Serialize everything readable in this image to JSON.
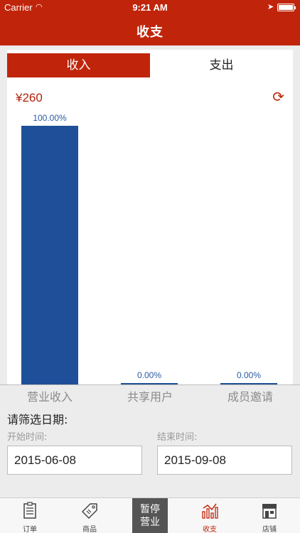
{
  "status_bar": {
    "carrier": "Carrier",
    "time": "9:21 AM"
  },
  "nav": {
    "title": "收支"
  },
  "segments": [
    {
      "label": "收入",
      "active": true
    },
    {
      "label": "支出",
      "active": false
    }
  ],
  "amount": "¥260",
  "chart_data": {
    "type": "bar",
    "categories": [
      "营业收入",
      "共享用户",
      "成员邀请"
    ],
    "values": [
      100.0,
      0.0,
      0.0
    ],
    "data_labels": [
      "100.00%",
      "0.00%",
      "0.00%"
    ],
    "ylim": [
      0,
      100
    ],
    "color": "#1f4f98"
  },
  "filter": {
    "title": "请筛选日期:",
    "start_label": "开始时间:",
    "start_value": "2015-06-08",
    "end_label": "结束时间:",
    "end_value": "2015-09-08"
  },
  "tabbar": {
    "orders": "订单",
    "products": "商品",
    "pause": "暂停营业",
    "finance": "收支",
    "store": "店铺"
  },
  "colors": {
    "brand": "#c0250b",
    "bar": "#1f4f98"
  }
}
